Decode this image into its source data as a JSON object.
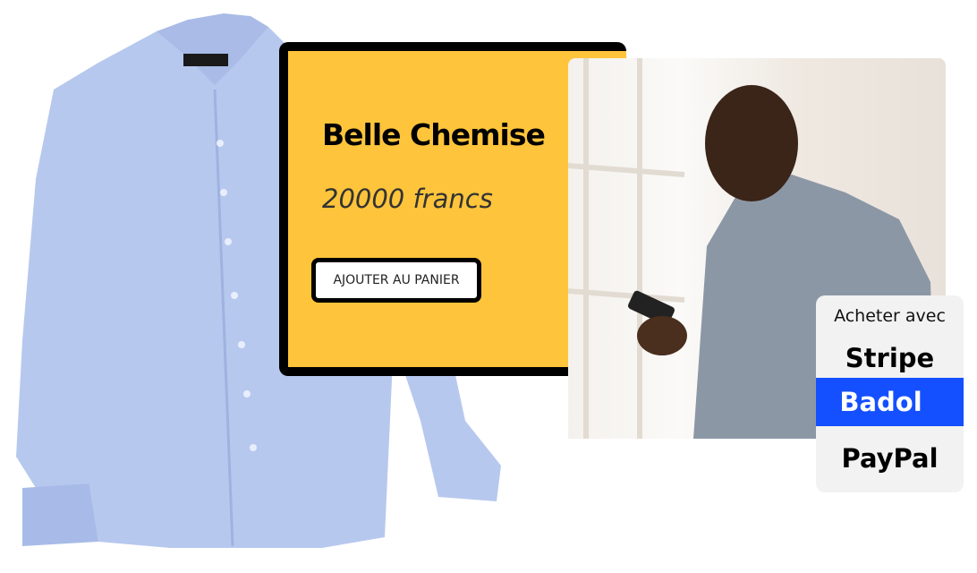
{
  "product": {
    "title": "Belle Chemise",
    "price": "20000 francs",
    "add_to_cart_label": "AJOUTER AU PANIER"
  },
  "payment": {
    "label": "Acheter avec",
    "options": [
      {
        "label": "Stripe",
        "selected": false
      },
      {
        "label": "Badol",
        "selected": true
      },
      {
        "label": "PayPal",
        "selected": false
      }
    ]
  },
  "colors": {
    "card": "#fec43b",
    "selected": "#1450ff",
    "shirt": "#b7c8ee"
  }
}
